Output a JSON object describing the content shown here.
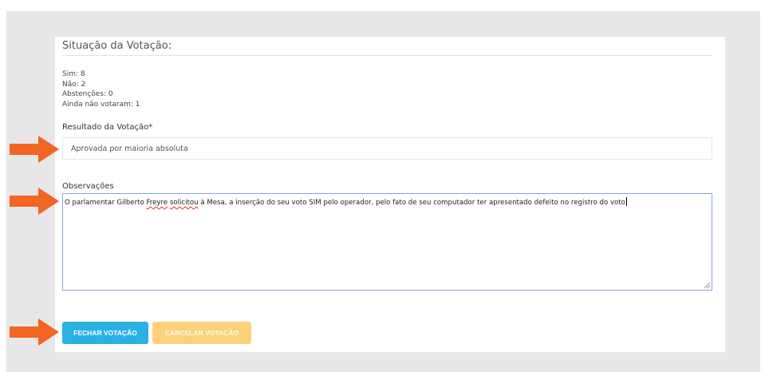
{
  "colors": {
    "backdrop": "#e7e7e8",
    "card": "#ffffff",
    "arrow": "#f26522",
    "close_button": "#2bb0e4",
    "cancel_button": "#fbd27a",
    "textarea_focus_border": "#8aa6d6"
  },
  "section": {
    "title": "Situação da Votação:"
  },
  "counts": {
    "sim": "Sim: 8",
    "nao": "Não: 2",
    "abstencoes": "Abstenções: 0",
    "ainda_nao_votaram": "Ainda não votaram: 1"
  },
  "resultado": {
    "label": "Resultado da Votação*",
    "value": "Aprovada por maioria absoluta"
  },
  "observacoes": {
    "label": "Observações",
    "text_before": "O parlamentar Gilberto ",
    "text_misspelled_1": "Freyre",
    "text_middle": " ",
    "text_misspelled_2": "solicitou",
    "text_after": "  à Mesa, a inserção do seu voto SIM pelo operador, pelo fato de seu computador  ter apresentado defeito no registro do  voto"
  },
  "buttons": {
    "close": "FECHAR VOTAÇÃO",
    "cancel": "CANCELAR VOTAÇÃO"
  },
  "icons": {
    "annotation_arrow": "arrow-right-icon",
    "resize": "resize-grip-icon"
  }
}
